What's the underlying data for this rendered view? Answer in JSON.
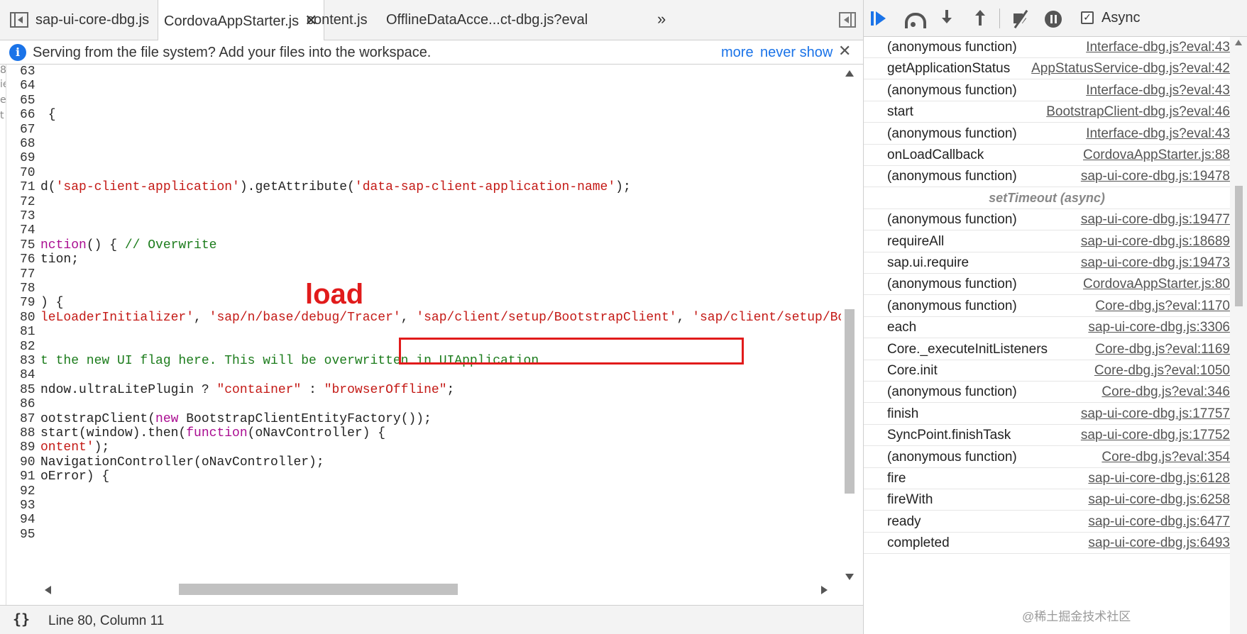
{
  "tabs": [
    {
      "label": "sap-ui-core-dbg.js",
      "active": false
    },
    {
      "label": "CordovaAppStarter.js",
      "active": true,
      "close": "✕"
    },
    {
      "label": "content.js",
      "active": false
    },
    {
      "label": "OfflineDataAcce...ct-dbg.js?eval",
      "active": false
    }
  ],
  "tab_overflow": "»",
  "infobar": {
    "icon": "info-icon",
    "message": "Serving from the file system? Add your files into the workspace.",
    "more": "more",
    "never_show": "never show",
    "close": "✕"
  },
  "edge_chars": [
    "8",
    "ie",
    "e",
    "t"
  ],
  "code_lines": [
    {
      "n": "63",
      "tokens": []
    },
    {
      "n": "64",
      "tokens": []
    },
    {
      "n": "65",
      "tokens": []
    },
    {
      "n": "66",
      "tokens": [
        {
          "t": " {",
          "c": ""
        }
      ]
    },
    {
      "n": "67",
      "tokens": []
    },
    {
      "n": "68",
      "tokens": []
    },
    {
      "n": "69",
      "tokens": []
    },
    {
      "n": "70",
      "tokens": []
    },
    {
      "n": "71",
      "tokens": [
        {
          "t": "d(",
          "c": ""
        },
        {
          "t": "'sap-client-application'",
          "c": "str"
        },
        {
          "t": ").getAttribute(",
          "c": ""
        },
        {
          "t": "'data-sap-client-application-name'",
          "c": "str"
        },
        {
          "t": ");",
          "c": ""
        }
      ]
    },
    {
      "n": "72",
      "tokens": []
    },
    {
      "n": "73",
      "tokens": []
    },
    {
      "n": "74",
      "tokens": []
    },
    {
      "n": "75",
      "tokens": [
        {
          "t": "nction",
          "c": "kw"
        },
        {
          "t": "() { ",
          "c": ""
        },
        {
          "t": "// Overwrite",
          "c": "com"
        }
      ]
    },
    {
      "n": "76",
      "tokens": [
        {
          "t": "tion;",
          "c": ""
        }
      ]
    },
    {
      "n": "77",
      "tokens": []
    },
    {
      "n": "78",
      "tokens": []
    },
    {
      "n": "79",
      "tokens": [
        {
          "t": ") {",
          "c": ""
        }
      ]
    },
    {
      "n": "80",
      "tokens": [
        {
          "t": "leLoaderInitializer'",
          "c": "str"
        },
        {
          "t": ", ",
          "c": ""
        },
        {
          "t": "'sap/n/base/debug/Tracer'",
          "c": "str"
        },
        {
          "t": ", ",
          "c": ""
        },
        {
          "t": "'sap/client/setup/BootstrapClient'",
          "c": "str"
        },
        {
          "t": ", ",
          "c": ""
        },
        {
          "t": "'sap/client/setup/Bo",
          "c": "str"
        }
      ]
    },
    {
      "n": "81",
      "tokens": []
    },
    {
      "n": "82",
      "tokens": []
    },
    {
      "n": "83",
      "tokens": [
        {
          "t": "t the new UI flag here. This will be overwritten in UIApplication",
          "c": "com"
        }
      ]
    },
    {
      "n": "84",
      "tokens": []
    },
    {
      "n": "85",
      "tokens": [
        {
          "t": "ndow.ultraLitePlugin ? ",
          "c": ""
        },
        {
          "t": "\"container\"",
          "c": "str"
        },
        {
          "t": " : ",
          "c": ""
        },
        {
          "t": "\"browserOffline\"",
          "c": "str"
        },
        {
          "t": ";",
          "c": ""
        }
      ]
    },
    {
      "n": "86",
      "tokens": []
    },
    {
      "n": "87",
      "tokens": [
        {
          "t": "ootstrapClient(",
          "c": ""
        },
        {
          "t": "new",
          "c": "kw"
        },
        {
          "t": " BootstrapClientEntityFactory());",
          "c": ""
        }
      ]
    },
    {
      "n": "88",
      "tokens": [
        {
          "t": "start(window).then(",
          "c": ""
        },
        {
          "t": "function",
          "c": "kw"
        },
        {
          "t": "(oNavController) {",
          "c": ""
        }
      ]
    },
    {
      "n": "89",
      "tokens": [
        {
          "t": "ontent'",
          "c": "str"
        },
        {
          "t": ");",
          "c": ""
        }
      ]
    },
    {
      "n": "90",
      "tokens": [
        {
          "t": "NavigationController(oNavController);",
          "c": ""
        }
      ]
    },
    {
      "n": "91",
      "tokens": [
        {
          "t": "oError) {",
          "c": ""
        }
      ]
    },
    {
      "n": "92",
      "tokens": []
    },
    {
      "n": "93",
      "tokens": []
    },
    {
      "n": "94",
      "tokens": []
    },
    {
      "n": "95",
      "tokens": []
    }
  ],
  "annotation": "load",
  "status": {
    "pretty_print": "{}",
    "cursor": "Line 80, Column 11"
  },
  "debugger": {
    "async_label": "Async",
    "async_checked": "✓"
  },
  "call_stack": [
    {
      "fn": "(anonymous function)",
      "loc": "Interface-dbg.js?eval:43"
    },
    {
      "fn": "getApplicationStatus",
      "loc": "AppStatusService-dbg.js?eval:42"
    },
    {
      "fn": "(anonymous function)",
      "loc": "Interface-dbg.js?eval:43"
    },
    {
      "fn": "start",
      "loc": "BootstrapClient-dbg.js?eval:46"
    },
    {
      "fn": "(anonymous function)",
      "loc": "Interface-dbg.js?eval:43"
    },
    {
      "fn": "onLoadCallback",
      "loc": "CordovaAppStarter.js:88"
    },
    {
      "fn": "(anonymous function)",
      "loc": "sap-ui-core-dbg.js:19478"
    },
    {
      "separator": "setTimeout (async)"
    },
    {
      "fn": "(anonymous function)",
      "loc": "sap-ui-core-dbg.js:19477"
    },
    {
      "fn": "requireAll",
      "loc": "sap-ui-core-dbg.js:18689"
    },
    {
      "fn": "sap.ui.require",
      "loc": "sap-ui-core-dbg.js:19473"
    },
    {
      "fn": "(anonymous function)",
      "loc": "CordovaAppStarter.js:80"
    },
    {
      "fn": "(anonymous function)",
      "loc": "Core-dbg.js?eval:1170"
    },
    {
      "fn": "each",
      "loc": "sap-ui-core-dbg.js:3306"
    },
    {
      "fn": "Core._executeInitListeners",
      "loc": "Core-dbg.js?eval:1169"
    },
    {
      "fn": "Core.init",
      "loc": "Core-dbg.js?eval:1050"
    },
    {
      "fn": "(anonymous function)",
      "loc": "Core-dbg.js?eval:346"
    },
    {
      "fn": "finish",
      "loc": "sap-ui-core-dbg.js:17757"
    },
    {
      "fn": "SyncPoint.finishTask",
      "loc": "sap-ui-core-dbg.js:17752"
    },
    {
      "fn": "(anonymous function)",
      "loc": "Core-dbg.js?eval:354"
    },
    {
      "fn": "fire",
      "loc": "sap-ui-core-dbg.js:6128"
    },
    {
      "fn": "fireWith",
      "loc": "sap-ui-core-dbg.js:6258"
    },
    {
      "fn": "ready",
      "loc": "sap-ui-core-dbg.js:6477"
    },
    {
      "fn": "completed",
      "loc": "sap-ui-core-dbg.js:6493"
    }
  ],
  "watermark": "@稀土掘金技术社区"
}
